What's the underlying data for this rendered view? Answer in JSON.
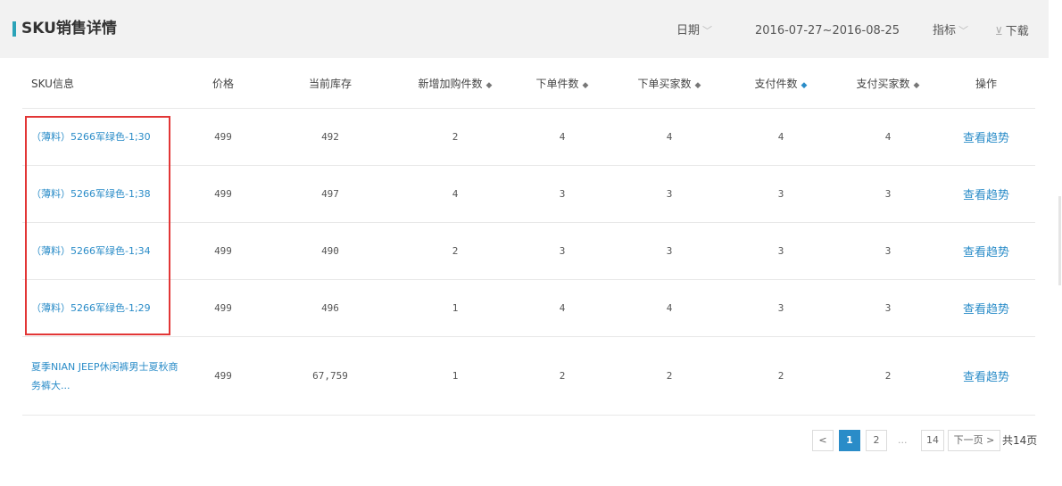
{
  "header": {
    "title": "SKU销售详情",
    "date_label": "日期",
    "date_range": "2016-07-27~2016-08-25",
    "indicator_label": "指标",
    "download_label": "下载"
  },
  "table": {
    "columns": [
      "SKU信息",
      "价格",
      "当前库存",
      "新增加购件数",
      "下单件数",
      "下单买家数",
      "支付件数",
      "支付买家数",
      "操作"
    ],
    "rows": [
      {
        "sku": "（薄料）5266军绿色-1;30",
        "price": "499",
        "stock": "492",
        "cart_adds": "2",
        "order_items": "4",
        "order_buyers": "4",
        "paid_items": "4",
        "paid_buyers": "4",
        "action": "查看趋势"
      },
      {
        "sku": "（薄料）5266军绿色-1;38",
        "price": "499",
        "stock": "497",
        "cart_adds": "4",
        "order_items": "3",
        "order_buyers": "3",
        "paid_items": "3",
        "paid_buyers": "3",
        "action": "查看趋势"
      },
      {
        "sku": "（薄料）5266军绿色-1;34",
        "price": "499",
        "stock": "490",
        "cart_adds": "2",
        "order_items": "3",
        "order_buyers": "3",
        "paid_items": "3",
        "paid_buyers": "3",
        "action": "查看趋势"
      },
      {
        "sku": "（薄料）5266军绿色-1;29",
        "price": "499",
        "stock": "496",
        "cart_adds": "1",
        "order_items": "4",
        "order_buyers": "4",
        "paid_items": "3",
        "paid_buyers": "3",
        "action": "查看趋势"
      },
      {
        "sku": "夏季NIAN JEEP休闲裤男士夏秋商务裤大...",
        "price": "499",
        "stock": "67,759",
        "cart_adds": "1",
        "order_items": "2",
        "order_buyers": "2",
        "paid_items": "2",
        "paid_buyers": "2",
        "action": "查看趋势"
      }
    ]
  },
  "pagination": {
    "prev": "<",
    "pages": [
      "1",
      "2"
    ],
    "ellipsis": "...",
    "last_page": "14",
    "next": "下一页 >",
    "total": "共14页"
  },
  "colors": {
    "accent": "#2a8cc8",
    "title_bar": "#2ba3b8",
    "highlight": "#e23636"
  }
}
